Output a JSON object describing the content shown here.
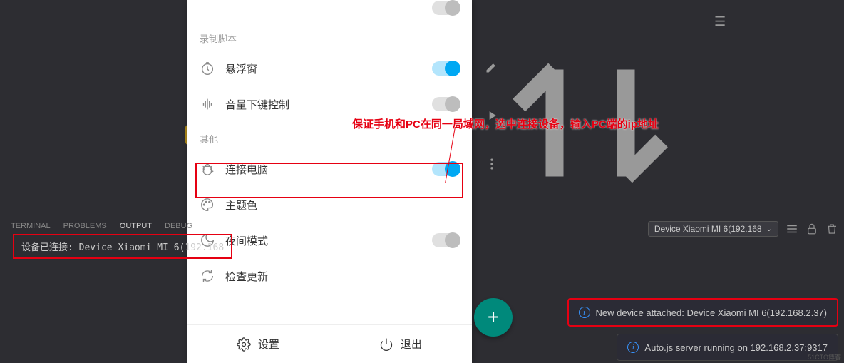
{
  "phone_panel": {
    "sections": {
      "record": "录制脚本",
      "other": "其他"
    },
    "items": {
      "truncated_toggle": true,
      "floating_window": {
        "label": "悬浮窗",
        "on": true,
        "icon": "timer-icon"
      },
      "volume_control": {
        "label": "音量下键控制",
        "on": false,
        "icon": "sound-icon"
      },
      "connect_pc": {
        "label": "连接电脑",
        "on": true,
        "icon": "bug-icon"
      },
      "theme_color": {
        "label": "主题色",
        "icon": "palette-icon"
      },
      "night_mode": {
        "label": "夜间模式",
        "on": false,
        "icon": "moon-icon"
      },
      "check_update": {
        "label": "检查更新",
        "icon": "refresh-icon"
      }
    },
    "footer": {
      "settings": "设置",
      "exit": "退出"
    }
  },
  "annotation_text": "保证手机和PC在同一局域网，选中连接设备，输入PC端的ip地址",
  "ide": {
    "tabs": {
      "terminal": "TERMINAL",
      "problems": "PROBLEMS",
      "output": "OUTPUT",
      "debug": "DEBUG"
    },
    "output_line": "设备已连接: Device Xiaomi MI 6(192.168",
    "device_dropdown": "Device Xiaomi MI 6(192.168"
  },
  "notifications": {
    "attached": "New device attached: Device Xiaomi MI 6(192.168.2.37)",
    "server": "Auto.js server running on 192.168.2.37:9317"
  },
  "watermark": "51CTO博客"
}
